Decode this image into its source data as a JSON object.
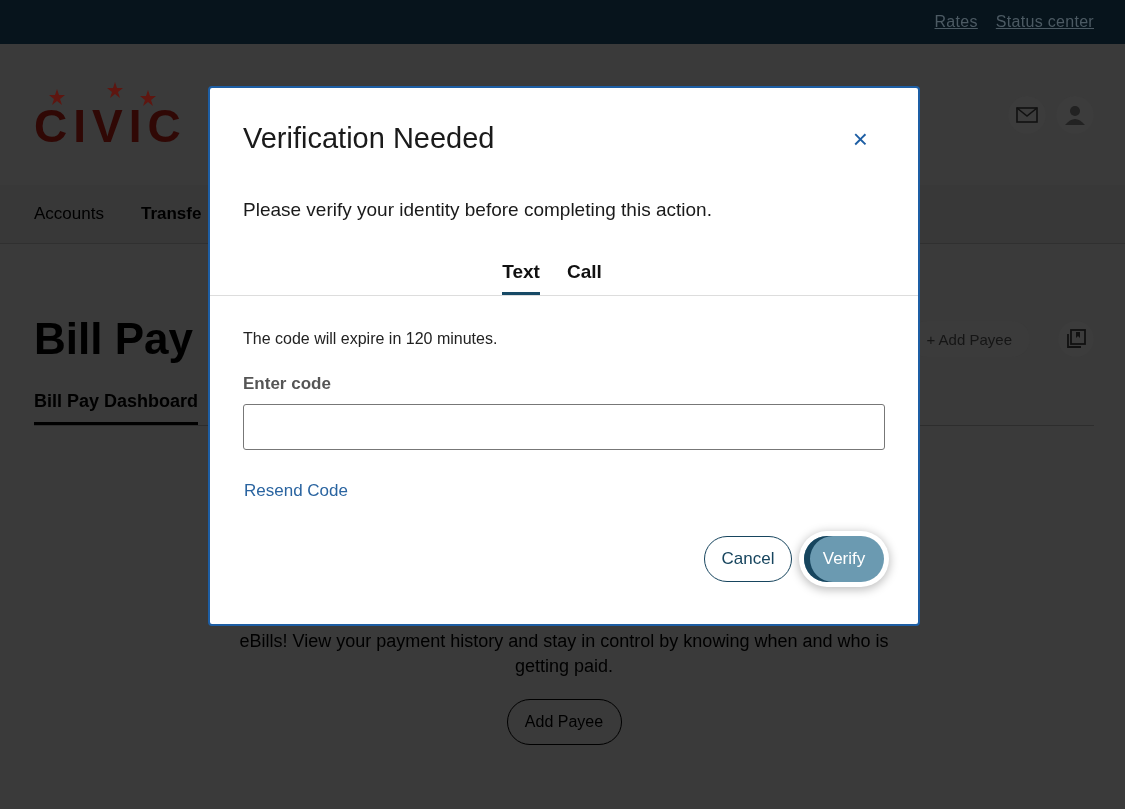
{
  "top_links": [
    "Rates",
    "Status center"
  ],
  "logo": {
    "text": "CIVIC"
  },
  "nav": [
    {
      "label": "Accounts",
      "bold": false
    },
    {
      "label": "Transfe",
      "bold": true
    }
  ],
  "page": {
    "title": "Bill Pay",
    "add_payee_button": "+ Add Payee",
    "tabs": [
      {
        "label": "Bill Pay Dashboard",
        "selected": true
      }
    ],
    "message": "eBills! View your payment history and stay in control by knowing when and who is getting paid.",
    "empty_button": "Add Payee"
  },
  "modal": {
    "title": "Verification Needed",
    "close": "×",
    "intro": "Please verify your identity before completing this action.",
    "tabs": [
      {
        "label": "Text",
        "selected": true
      },
      {
        "label": "Call",
        "selected": false
      }
    ],
    "expiry_note": "The code will expire in 120 minutes.",
    "field": {
      "label": "Enter code"
    },
    "resend_link": "Resend Code",
    "buttons": [
      {
        "label": "Cancel",
        "kind": "secondary"
      },
      {
        "label": "Verify",
        "kind": "primary"
      }
    ]
  }
}
